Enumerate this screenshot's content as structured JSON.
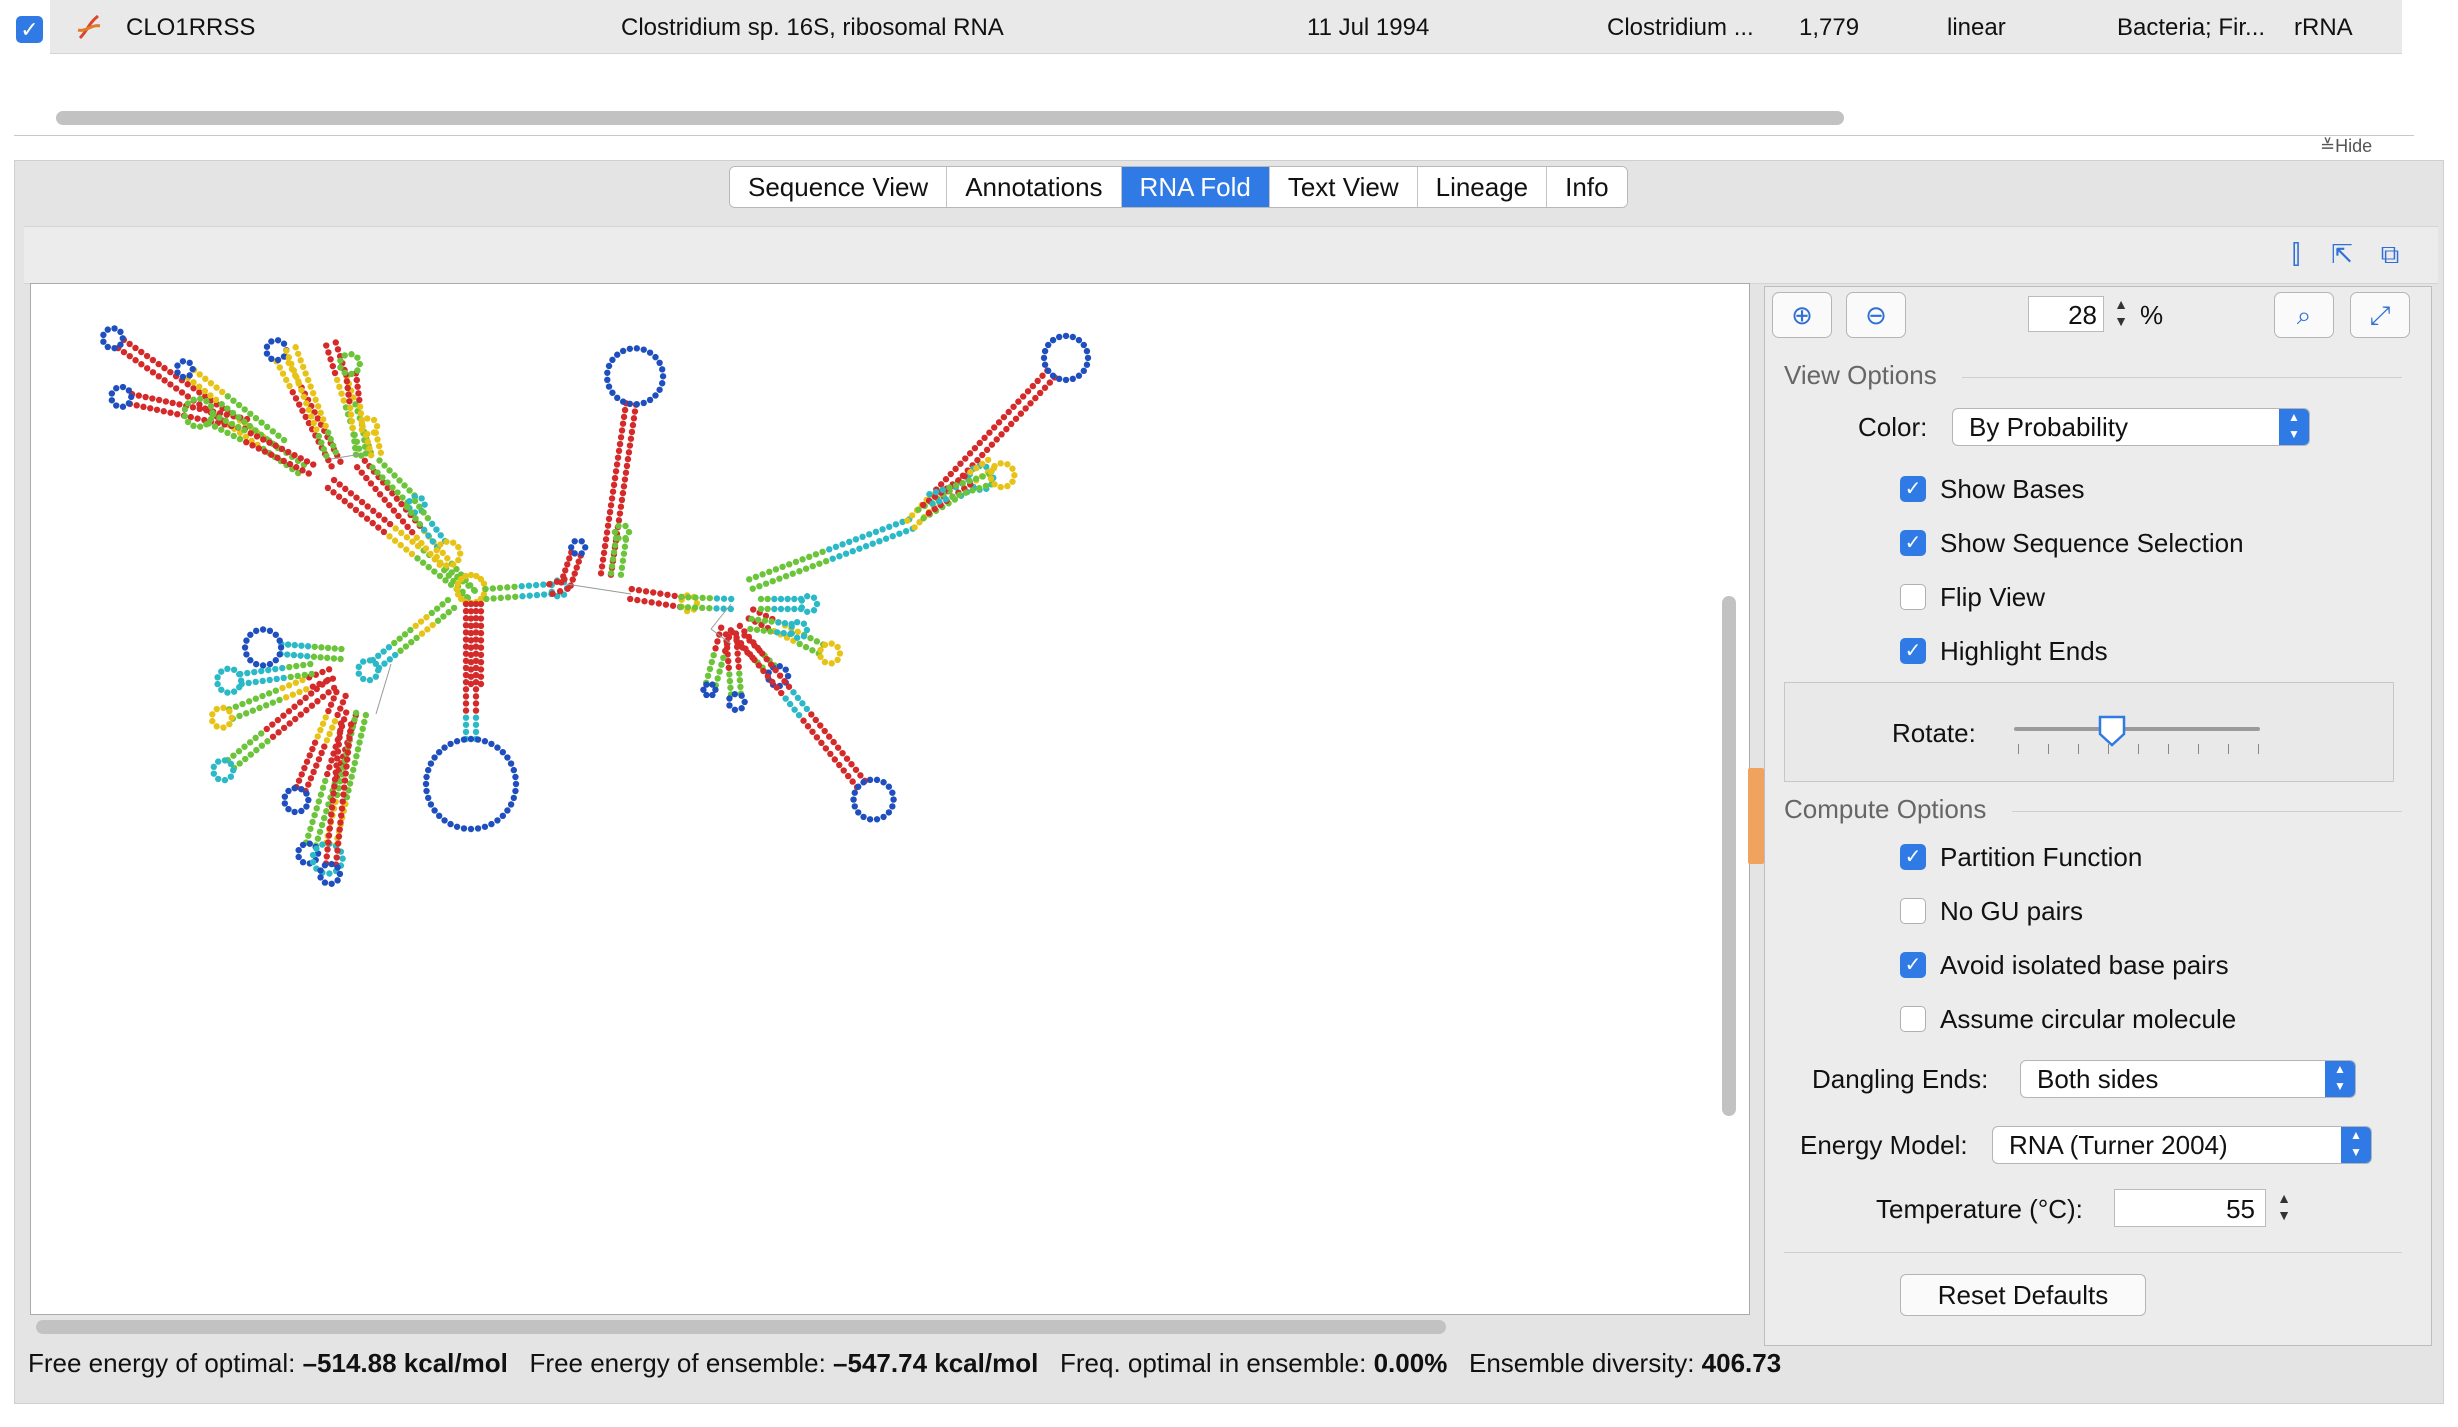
{
  "record": {
    "selected": true,
    "name": "CLO1RRSS",
    "description": "Clostridium sp. 16S, ribosomal RNA",
    "date": "11 Jul 1994",
    "organism": "Clostridium ...",
    "length": "1,779",
    "topology": "linear",
    "lineage": "Bacteria; Fir...",
    "type": "rRNA"
  },
  "hide_label": "Hide",
  "tabs": [
    {
      "label": "Sequence View",
      "active": false
    },
    {
      "label": "Annotations",
      "active": false
    },
    {
      "label": "RNA Fold",
      "active": true
    },
    {
      "label": "Text View",
      "active": false
    },
    {
      "label": "Lineage",
      "active": false
    },
    {
      "label": "Info",
      "active": false
    }
  ],
  "zoom": {
    "value": "28",
    "unit": "%"
  },
  "view_options": {
    "title": "View Options",
    "color_label": "Color:",
    "color_value": "By Probability",
    "show_bases": {
      "label": "Show Bases",
      "checked": true
    },
    "show_selection": {
      "label": "Show Sequence Selection",
      "checked": true
    },
    "flip_view": {
      "label": "Flip View",
      "checked": false
    },
    "highlight_ends": {
      "label": "Highlight Ends",
      "checked": true
    },
    "rotate_label": "Rotate:",
    "rotate_level": 0.4
  },
  "compute_options": {
    "title": "Compute Options",
    "partition_function": {
      "label": "Partition Function",
      "checked": true
    },
    "no_gu_pairs": {
      "label": "No GU pairs",
      "checked": false
    },
    "avoid_isolated": {
      "label": "Avoid isolated base pairs",
      "checked": true
    },
    "circular": {
      "label": "Assume circular molecule",
      "checked": false
    },
    "dangling_label": "Dangling Ends:",
    "dangling_value": "Both sides",
    "energy_label": "Energy Model:",
    "energy_value": "RNA (Turner 2004)",
    "temperature_label": "Temperature (°C):",
    "temperature_value": "55"
  },
  "reset_label": "Reset Defaults",
  "status": {
    "optimal_label": "Free energy of optimal:",
    "optimal_value": "–514.88 kcal/mol",
    "ensemble_label": "Free energy of ensemble:",
    "ensemble_value": "–547.74 kcal/mol",
    "freq_label": "Freq. optimal in ensemble:",
    "freq_value": "0.00%",
    "diversity_label": "Ensemble diversity:",
    "diversity_value": "406.73"
  },
  "colors": {
    "accent": "#2f7ae5",
    "high_prob": "#d42a2a",
    "mid_high": "#e8c317",
    "mid": "#6cc43a",
    "mid_low": "#2bb9c7",
    "low_prob": "#1f4fbf"
  },
  "icons": [
    "dna-icon",
    "split-view-icon",
    "collapse-icon",
    "float-window-icon",
    "zoom-in-icon",
    "zoom-out-icon",
    "zoom-to-selection-icon",
    "fit-to-window-icon"
  ]
}
